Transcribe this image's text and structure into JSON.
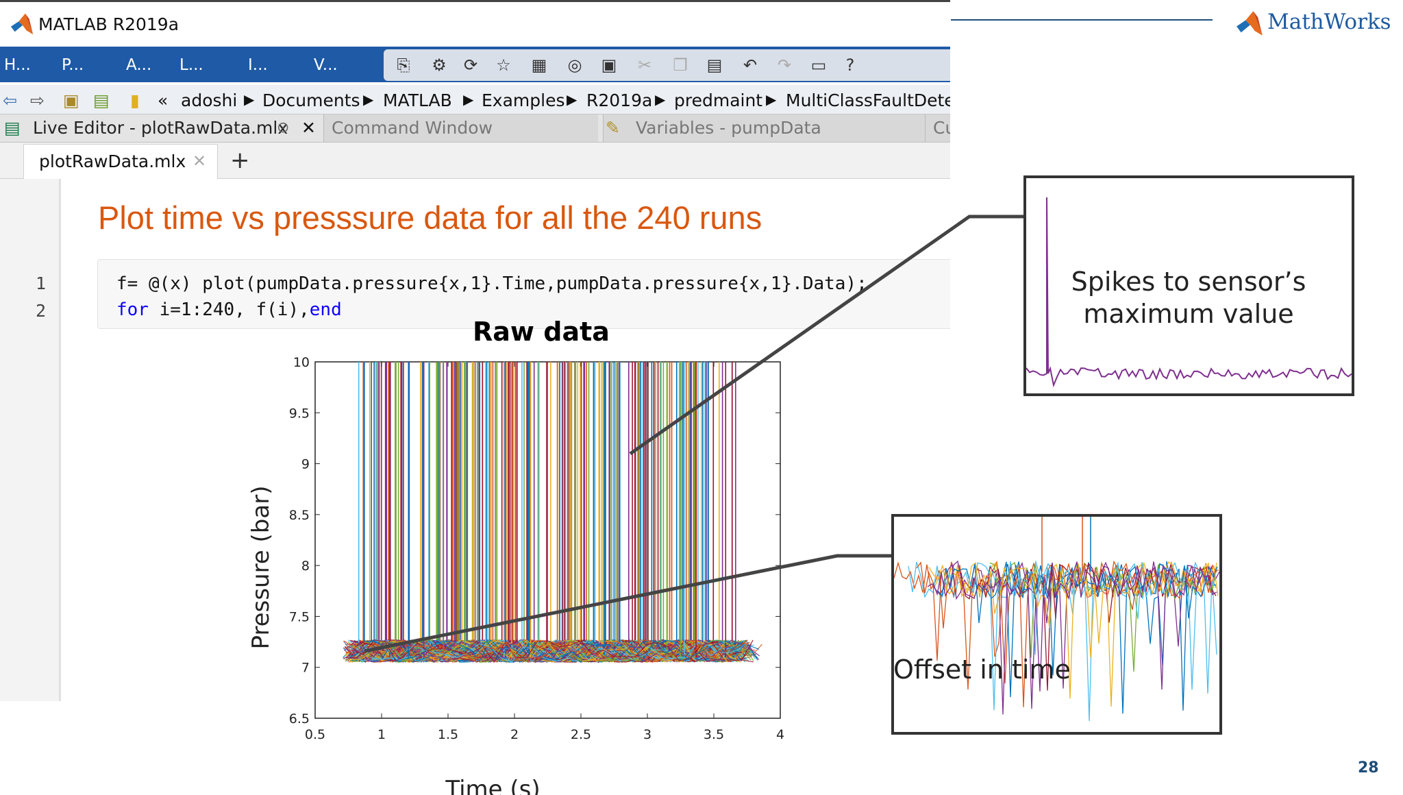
{
  "window": {
    "title": "MATLAB R2019a"
  },
  "toolstrip": {
    "tabs": [
      "H...",
      "P...",
      "A...",
      "L...",
      "I...",
      "V..."
    ]
  },
  "toolbar_icons": [
    "new-file-icon",
    "settings-icon",
    "run-icon",
    "favorites-icon",
    "layout-icon",
    "idea-icon",
    "save-icon",
    "cut-icon",
    "copy-icon",
    "paste-icon",
    "undo-icon",
    "redo-icon",
    "window-icon",
    "help-icon"
  ],
  "address": {
    "prefix": "«",
    "crumbs": [
      "adoshi",
      "Documents",
      "MATLAB",
      "Examples",
      "R2019a",
      "predmaint",
      "MultiClassFaultDetec"
    ]
  },
  "panel_tabs": {
    "live_editor": "Live Editor - plotRawData.mlx",
    "command_window": "Command Window",
    "variables": "Variables - pumpData",
    "current": "Cu"
  },
  "file_tab": {
    "name": "plotRawData.mlx",
    "add": "+"
  },
  "editor": {
    "heading": "Plot time vs presssure data for all the 240 runs",
    "line_numbers": [
      "1",
      "2"
    ],
    "line1": "f= @(x) plot(pumpData.pressure{x,1}.Time,pumpData.pressure{x,1}.Data);",
    "line2_kw1": "for",
    "line2_mid": " i=1:240, f(i),",
    "line2_kw2": "end"
  },
  "chart_data": {
    "type": "line",
    "title": "Raw data",
    "xlabel": "Time (s)",
    "ylabel": "Pressure (bar)",
    "xlim": [
      0.5,
      4
    ],
    "ylim": [
      6.5,
      10
    ],
    "xticks": [
      "0.5",
      "1",
      "1.5",
      "2",
      "2.5",
      "3",
      "3.5",
      "4"
    ],
    "yticks": [
      "6.5",
      "7",
      "7.5",
      "8",
      "8.5",
      "9",
      "9.5",
      "10"
    ],
    "series_count": 240,
    "x_range": [
      0.71,
      3.69
    ],
    "baseline_band": [
      7.0,
      7.28
    ],
    "spike_max": 10,
    "colors": [
      "#0072BD",
      "#D95319",
      "#EDB120",
      "#7E2F8E",
      "#77AC30",
      "#4DBEEE",
      "#A2142F"
    ]
  },
  "annotations": {
    "spikes": "Spikes to sensor’s maximum value",
    "offset": "Offset in time"
  },
  "brand": {
    "name": "MathWorks"
  },
  "slide_number": "28"
}
